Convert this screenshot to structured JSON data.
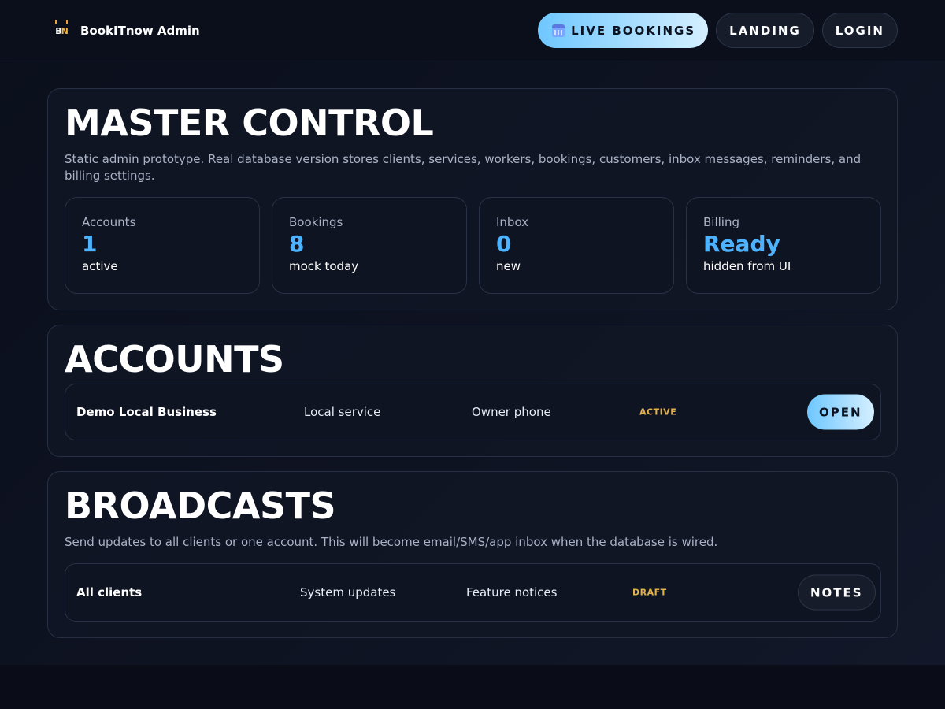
{
  "header": {
    "brand_logo_b": "B",
    "brand_logo_n": "N",
    "brand_name": "BookITnow Admin",
    "nav": {
      "live_bookings": "LIVE BOOKINGS",
      "landing": "LANDING",
      "login": "LOGIN"
    }
  },
  "master_control": {
    "title": "MASTER CONTROL",
    "description": "Static admin prototype. Real database version stores clients, services, workers, bookings, customers, inbox messages, reminders, and billing settings.",
    "stats": [
      {
        "label": "Accounts",
        "value": "1",
        "sub": "active"
      },
      {
        "label": "Bookings",
        "value": "8",
        "sub": "mock today"
      },
      {
        "label": "Inbox",
        "value": "0",
        "sub": "new"
      },
      {
        "label": "Billing",
        "value": "Ready",
        "sub": "hidden from UI"
      }
    ]
  },
  "accounts": {
    "title": "ACCOUNTS",
    "rows": [
      {
        "name": "Demo Local Business",
        "type": "Local service",
        "contact": "Owner phone",
        "status": "ACTIVE",
        "action": "OPEN"
      }
    ]
  },
  "broadcasts": {
    "title": "BROADCASTS",
    "description": "Send updates to all clients or one account. This will become email/SMS/app inbox when the database is wired.",
    "rows": [
      {
        "target": "All clients",
        "topic": "System updates",
        "kind": "Feature notices",
        "status": "DRAFT",
        "action": "NOTES"
      }
    ]
  },
  "colors": {
    "accent": "#4db3ff",
    "badge": "#e2b24a",
    "background": "#0a0d18"
  },
  "icons": {
    "brand": "brand-logo-icon",
    "live_bookings": "calendar-icon"
  }
}
